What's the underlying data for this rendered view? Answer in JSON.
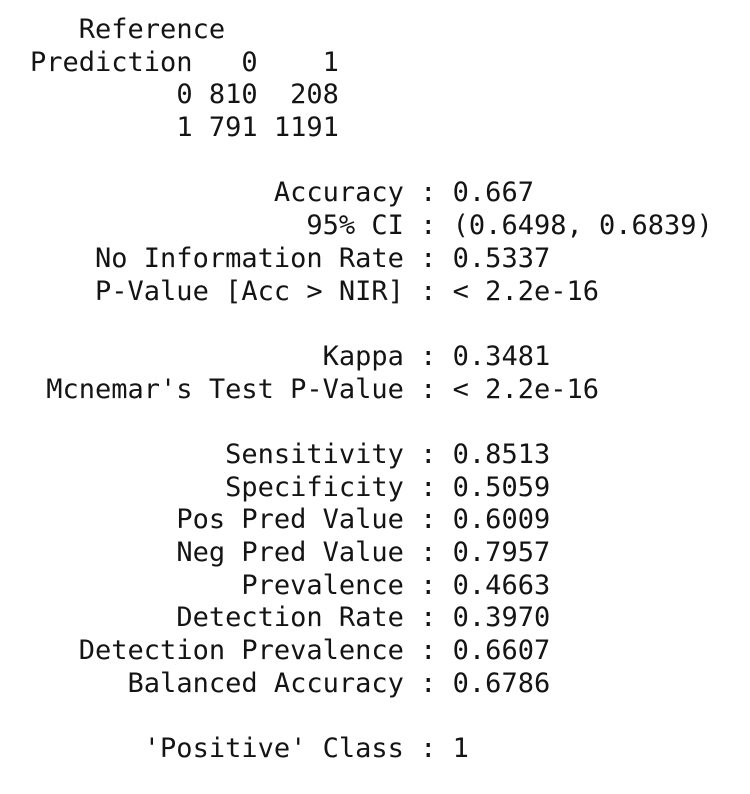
{
  "confusion_matrix": {
    "header_reference": "Reference",
    "header_prediction": "Prediction",
    "reference_levels": [
      "0",
      "1"
    ],
    "rows": [
      {
        "prediction": "0",
        "values": [
          "810",
          "208"
        ]
      },
      {
        "prediction": "1",
        "values": [
          "791",
          "1191"
        ]
      }
    ]
  },
  "overall_stats": [
    {
      "key": "Accuracy",
      "value": "0.667"
    },
    {
      "key": "95% CI",
      "value": "(0.6498, 0.6839)"
    },
    {
      "key": "No Information Rate",
      "value": "0.5337"
    },
    {
      "key": "P-Value [Acc > NIR]",
      "value": "< 2.2e-16"
    }
  ],
  "agreement_stats": [
    {
      "key": "Kappa",
      "value": "0.3481"
    },
    {
      "key": "Mcnemar's Test P-Value",
      "value": "< 2.2e-16"
    }
  ],
  "class_stats": [
    {
      "key": "Sensitivity",
      "value": "0.8513"
    },
    {
      "key": "Specificity",
      "value": "0.5059"
    },
    {
      "key": "Pos Pred Value",
      "value": "0.6009"
    },
    {
      "key": "Neg Pred Value",
      "value": "0.7957"
    },
    {
      "key": "Prevalence",
      "value": "0.4663"
    },
    {
      "key": "Detection Rate",
      "value": "0.3970"
    },
    {
      "key": "Detection Prevalence",
      "value": "0.6607"
    },
    {
      "key": "Balanced Accuracy",
      "value": "0.6786"
    }
  ],
  "positive_class": {
    "key": "'Positive' Class",
    "value": "1"
  },
  "colors": {
    "text": "#141414",
    "background": "#ffffff"
  }
}
